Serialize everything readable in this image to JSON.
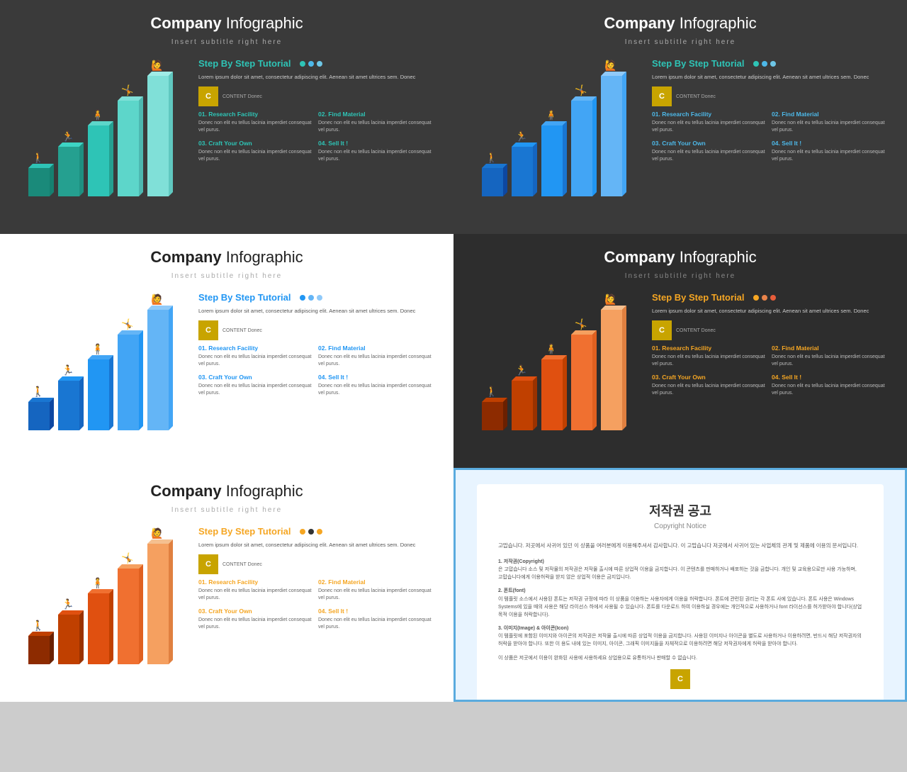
{
  "slides": [
    {
      "id": 1,
      "theme": "teal",
      "bg": "dark",
      "title_bold": "Company",
      "title_light": " Infographic",
      "subtitle": "Insert subtitle right here",
      "tutorial_title": "Step By Step Tutorial",
      "body_text": "Lorem ipsum dolor sit amet, consectetur\nadipiscing elit. Aenean sit amet ultrices sem.\nDonec",
      "logo_text": "CONTENT\nDonec",
      "items": [
        {
          "num": "01.",
          "title": "Research Facility",
          "body": "Donec non elit eu tellus lacinia\nimperdiet consequat vel purus."
        },
        {
          "num": "02.",
          "title": "Find Material",
          "body": "Donec non elit eu tellus lacinia\nimperdiet consequat vel purus."
        },
        {
          "num": "03.",
          "title": "Craft Your Own",
          "body": "Donec non elit eu tellus lacinia\nimperdiet consequat vel purus."
        },
        {
          "num": "04.",
          "title": "Sell It !",
          "body": "Donec non elit eu tellus lacinia\nimperdiet consequat vel purus."
        }
      ],
      "bars": [
        40,
        70,
        95,
        125,
        160
      ],
      "bar_color": "teal"
    },
    {
      "id": 2,
      "theme": "blue",
      "bg": "dark",
      "title_bold": "Company",
      "title_light": " Infographic",
      "subtitle": "Insert subtitle right here",
      "tutorial_title": "Step By Step Tutorial",
      "body_text": "Lorem ipsum dolor sit amet, consectetur\nadipiscing elit. Aenean sit amet ultrices sem.\nDonec",
      "logo_text": "CONTENT\nDonec",
      "items": [
        {
          "num": "01.",
          "title": "Research Facility",
          "body": "Donec non elit eu tellus lacinia\nimperdiet consequat vel purus."
        },
        {
          "num": "02.",
          "title": "Find Material",
          "body": "Donec non elit eu tellus lacinia\nimperdiet consequat vel purus."
        },
        {
          "num": "03.",
          "title": "Craft Your Own",
          "body": "Donec non elit eu tellus lacinia\nimperdiet consequat vel purus."
        },
        {
          "num": "04.",
          "title": "Sell It !",
          "body": "Donec non elit eu tellus lacinia\nimperdiet consequat vel purus."
        }
      ],
      "bars": [
        40,
        70,
        95,
        125,
        160
      ],
      "bar_color": "blue-dark"
    },
    {
      "id": 3,
      "theme": "blue",
      "bg": "light",
      "title_bold": "Company",
      "title_light": " Infographic",
      "subtitle": "Insert subtitle right here",
      "tutorial_title": "Step By Step Tutorial",
      "body_text": "Lorem ipsum dolor sit amet, consectetur\nadipiscing elit. Aenean sit amet ultrices sem.\nDonec",
      "logo_text": "CONTENT\nDonec",
      "items": [
        {
          "num": "01.",
          "title": "Research Facility",
          "body": "Donec non elit eu tellus lacinia\nimperdiet consequat vel purus."
        },
        {
          "num": "02.",
          "title": "Find Material",
          "body": "Donec non elit eu tellus lacinia\nimperdiet consequat vel purus."
        },
        {
          "num": "03.",
          "title": "Craft Your Own",
          "body": "Donec non elit eu tellus lacinia\nimperdiet consequat vel purus."
        },
        {
          "num": "04.",
          "title": "Sell It !",
          "body": "Donec non elit eu tellus lacinia\nimperdiet consequat vel purus."
        }
      ],
      "bars": [
        40,
        70,
        95,
        125,
        160
      ],
      "bar_color": "blue"
    },
    {
      "id": 4,
      "theme": "orange",
      "bg": "dark",
      "title_bold": "Company",
      "title_light": " Infographic",
      "subtitle": "Insert subtitle right here",
      "tutorial_title": "Step By Step Tutorial",
      "body_text": "Lorem ipsum dolor sit amet, consectetur\nadipiscing elit. Aenean sit amet ultrices sem.\nDonec",
      "logo_text": "CONTENT\nDonec",
      "items": [
        {
          "num": "01.",
          "title": "Research Facility",
          "body": "Donec non elit eu tellus lacinia\nimperdiet consequat vel purus."
        },
        {
          "num": "02.",
          "title": "Find Material",
          "body": "Donec non elit eu tellus lacinia\nimperdiet consequat vel purus."
        },
        {
          "num": "03.",
          "title": "Craft Your Own",
          "body": "Donec non elit eu tellus lacinia\nimperdiet consequat vel purus."
        },
        {
          "num": "04.",
          "title": "Sell It !",
          "body": "Donec non elit eu tellus lacinia\nimperdiet consequat vel purus."
        }
      ],
      "bars": [
        40,
        70,
        95,
        125,
        160
      ],
      "bar_color": "orange"
    },
    {
      "id": 5,
      "theme": "orange-red",
      "bg": "light",
      "title_bold": "Company",
      "title_light": " Infographic",
      "subtitle": "Insert subtitle right here",
      "tutorial_title": "Step By Step Tutorial",
      "body_text": "Lorem ipsum dolor sit amet, consectetur\nadipiscing elit. Aenean sit amet ultrices sem.\nDonec",
      "logo_text": "CONTENT\nDonec",
      "items": [
        {
          "num": "01.",
          "title": "Research Facility",
          "body": "Donec non elit eu tellus lacinia\nimperdiet consequat vel purus."
        },
        {
          "num": "02.",
          "title": "Find Material",
          "body": "Donec non elit eu tellus lacinia\nimperdiet consequat vel purus."
        },
        {
          "num": "03.",
          "title": "Craft Your Own",
          "body": "Donec non elit eu tellus lacinia\nimperdiet consequat vel purus."
        },
        {
          "num": "04.",
          "title": "Sell It !",
          "body": "Donec non elit eu tellus lacinia\nimperdiet consequat vel purus."
        }
      ],
      "bars": [
        40,
        70,
        95,
        125,
        160
      ],
      "bar_color": "red-orange"
    }
  ],
  "copyright": {
    "title": "저작권 공고",
    "subtitle": "Copyright Notice",
    "section1": "고맙습니다. 저곳에서 사귀어 있던 이 상품을 여러분에게 이용해주셔서 감사합니다. 이 고맙습니다 저곳에서 사귀어 있는 사업체의 관계 및 제품에 이용의 문서입니다.",
    "section2_title": "1. 저작권(Copyright)",
    "section2": "은 고맙습니다 소스 및 저작물의 저작권은 저작물 출시에 따른 상업적 이용을 금지합니다. 이 콘텐츠를 판매하거나 배포하는 것을 금합니다. 개인 및 교육용으로만 사용 가능하며, 고맙습니다에게 이용허락을 받지 않은 상업적 이용은 금지입니다.",
    "section3_title": "2. 폰트(font)",
    "section3": "이 템플릿 소스에서 사용된 폰트는 저작권 규정에 따라 이 상품을 이용하는 사용자에게 이용을 허락합니다. 폰트에 관련된 권리는 각 폰트 사에 있습니다. 폰트 사용은 Windows Systems에 있을 때의 사용은 해당 라이선스 하에서 사용될 수 있습니다. 폰트를 다운로드 하여 이용하실 경우에는 개인적으로 사용하거나 font 라이선스를 허가받아야 합니다(상업목적 이용을 허락합니다).",
    "section4_title": "3. 이미지(Image) & 아이콘(Icon)",
    "section4": "이 템플릿에 포함된 이미지와 아이콘의 저작권은 저작물 출시에 따른 상업적 이용을 금지합니다. 사용된 이미지나 아이콘을 별도로 사용하거나 이용하려면, 반드시 해당 저작권자의 허락을 받아야 합니다. 또한 이 용도 내에 있는 이미지, 아이콘, 그래픽 이미지들을 자체적으로 이용하려면 해당 저작권자에게 허락을 받아야 합니다.",
    "section5": "이 상품은 저곳에서 이용이 완화된 사용에 사용하세요 상업용으로 유통하거나 판매할 수 없습니다."
  }
}
